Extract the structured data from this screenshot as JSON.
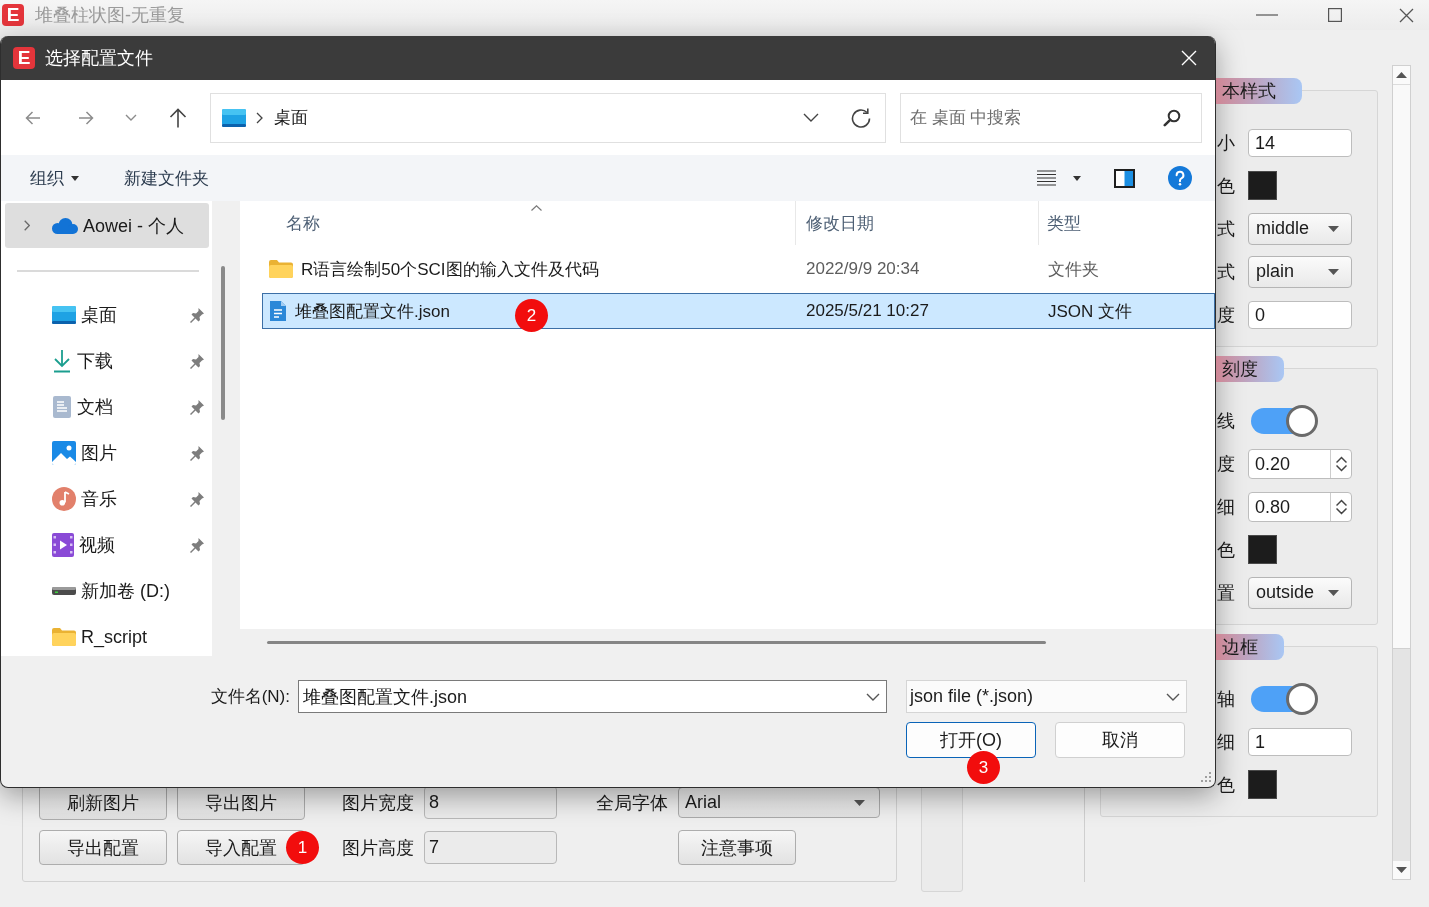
{
  "app": {
    "logo": "E",
    "title": "堆叠柱状图-无重复"
  },
  "properties": {
    "groups": [
      {
        "title": "本样式",
        "rows": [
          {
            "kind": "text",
            "label": "小",
            "value": "14"
          },
          {
            "kind": "color",
            "label": "色",
            "color": "#1c1c1c"
          },
          {
            "kind": "select",
            "label": "式",
            "value": "middle"
          },
          {
            "kind": "select",
            "label": "式",
            "value": "plain"
          },
          {
            "kind": "text",
            "label": "度",
            "value": "0"
          }
        ]
      },
      {
        "title": "刻度",
        "rows": [
          {
            "kind": "toggle",
            "label": "线",
            "on": true
          },
          {
            "kind": "spin",
            "label": "度",
            "value": "0.20"
          },
          {
            "kind": "spin",
            "label": "细",
            "value": "0.80"
          },
          {
            "kind": "color",
            "label": "色",
            "color": "#1c1c1c"
          },
          {
            "kind": "select",
            "label": "置",
            "value": "outside"
          }
        ]
      },
      {
        "title": "边框",
        "rows": [
          {
            "kind": "toggle",
            "label": "轴",
            "on": true
          },
          {
            "kind": "text",
            "label": "细",
            "value": "1"
          },
          {
            "kind": "color",
            "label": "色",
            "color": "#1c1c1c"
          }
        ]
      }
    ]
  },
  "bottom_panel": {
    "buttons": [
      {
        "label": "刷新图片"
      },
      {
        "label": "导出图片"
      },
      {
        "label": "导出配置"
      },
      {
        "label": "导入配置",
        "step": "1"
      }
    ],
    "fields": [
      {
        "label": "图片宽度",
        "value": "8"
      },
      {
        "label": "图片高度",
        "value": "7"
      }
    ],
    "font": {
      "label": "全局字体",
      "value": "Arial"
    },
    "notes_button": {
      "label": "注意事项"
    }
  },
  "dialog": {
    "logo": "E",
    "title": "选择配置文件",
    "address": {
      "location": "桌面"
    },
    "search": {
      "placeholder": "在 桌面 中搜索"
    },
    "toolbar": [
      {
        "label": "组织",
        "dropdown": true
      },
      {
        "label": "新建文件夹",
        "dropdown": false
      }
    ],
    "sidebar": {
      "accounts": [
        {
          "kind": "cloud",
          "label": "Aowei - 个人",
          "selected": true,
          "expandable": true
        }
      ],
      "places": [
        {
          "kind": "desktop",
          "label": "桌面",
          "pinned": true,
          "selected": false
        },
        {
          "kind": "download",
          "label": "下载",
          "pinned": true,
          "selected": false
        },
        {
          "kind": "documents",
          "label": "文档",
          "pinned": true,
          "selected": false
        },
        {
          "kind": "pictures",
          "label": "图片",
          "pinned": true,
          "selected": false
        },
        {
          "kind": "music",
          "label": "音乐",
          "pinned": true,
          "selected": false
        },
        {
          "kind": "videos",
          "label": "视频",
          "pinned": true,
          "selected": false
        },
        {
          "kind": "drive",
          "label": "新加卷 (D:)",
          "pinned": false,
          "selected": false
        },
        {
          "kind": "folder",
          "label": "R_script",
          "pinned": false,
          "selected": false
        }
      ]
    },
    "files": {
      "columns": [
        {
          "label": "名称",
          "sorted": true
        },
        {
          "label": "修改日期",
          "sorted": false
        },
        {
          "label": "类型",
          "sorted": false
        }
      ],
      "rows": [
        {
          "kind": "folder",
          "name": "R语言绘制50个SCI图的输入文件及代码",
          "modified": "2022/9/9 20:34",
          "type": "文件夹",
          "selected": false
        },
        {
          "kind": "json",
          "name": "堆叠图配置文件.json",
          "modified": "2025/5/21 10:27",
          "type": "JSON 文件",
          "selected": true,
          "step": "2"
        }
      ]
    },
    "filename": {
      "label": "文件名(N):",
      "value": "堆叠图配置文件.json"
    },
    "filter": {
      "value": "json file (*.json)"
    },
    "buttons": [
      {
        "label": "打开(O)",
        "default": true,
        "step": "3"
      },
      {
        "label": "取消",
        "default": false
      }
    ]
  }
}
